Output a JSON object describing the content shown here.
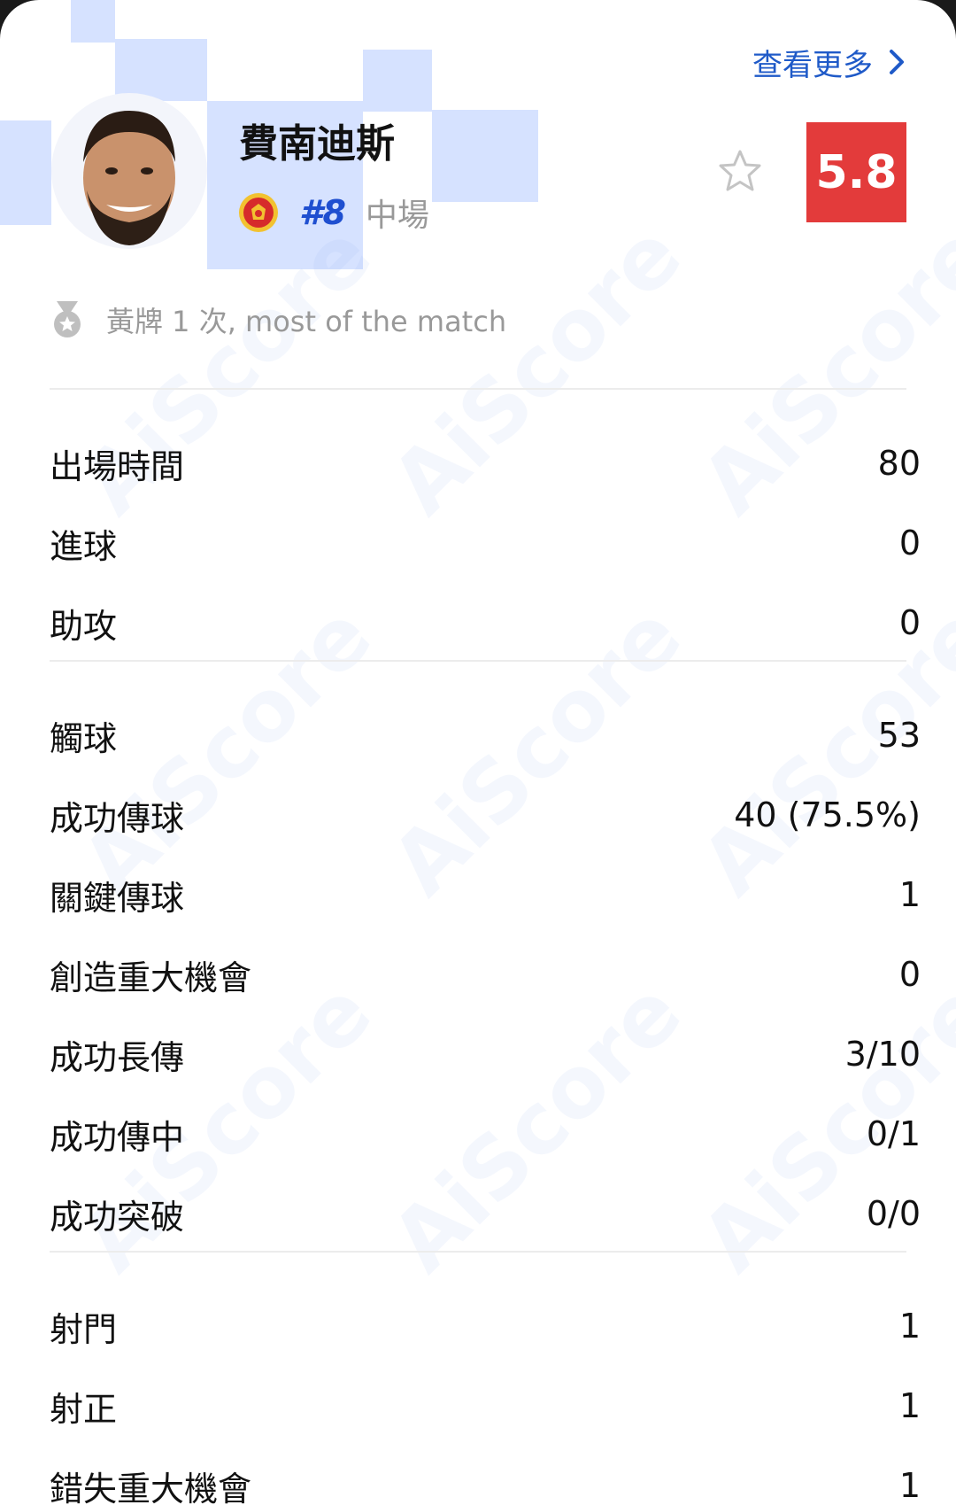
{
  "header": {
    "view_more": "查看更多",
    "player_name": "費南迪斯",
    "jersey_number": "#8",
    "position": "中場",
    "rating": "5.8",
    "rating_color": "#e33b3b",
    "accent_color": "#1f5ac8"
  },
  "card_note": "黃牌 1 次, most of the match",
  "watermark": "AiScore",
  "stats": [
    {
      "label": "出場時間",
      "value": "80"
    },
    {
      "label": "進球",
      "value": "0"
    },
    {
      "label": "助攻",
      "value": "0"
    },
    {
      "label": "觸球",
      "value": "53"
    },
    {
      "label": "成功傳球",
      "value": "40 (75.5%)"
    },
    {
      "label": "關鍵傳球",
      "value": "1"
    },
    {
      "label": "創造重大機會",
      "value": "0"
    },
    {
      "label": "成功長傳",
      "value": "3/10"
    },
    {
      "label": "成功傳中",
      "value": "0/1"
    },
    {
      "label": "成功突破",
      "value": "0/0"
    },
    {
      "label": "射門",
      "value": "1"
    },
    {
      "label": "射正",
      "value": "1"
    },
    {
      "label": "錯失重大機會",
      "value": "1"
    }
  ]
}
